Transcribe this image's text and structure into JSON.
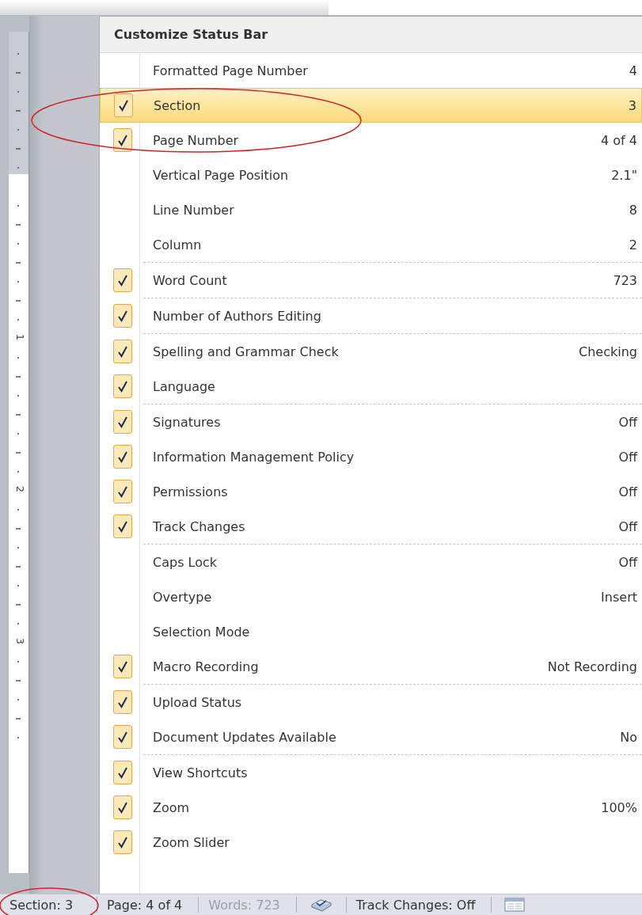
{
  "menu": {
    "title": "Customize Status Bar",
    "groups": [
      [
        {
          "label": "Formatted Page Number",
          "value": "4",
          "checked": false,
          "selected": false
        },
        {
          "label": "Section",
          "value": "3",
          "checked": true,
          "selected": true
        },
        {
          "label": "Page Number",
          "value": "4 of 4",
          "checked": true,
          "selected": false
        },
        {
          "label": "Vertical Page Position",
          "value": "2.1\"",
          "checked": false,
          "selected": false
        },
        {
          "label": "Line Number",
          "value": "8",
          "checked": false,
          "selected": false
        },
        {
          "label": "Column",
          "value": "2",
          "checked": false,
          "selected": false
        }
      ],
      [
        {
          "label": "Word Count",
          "value": "723",
          "checked": true,
          "selected": false
        }
      ],
      [
        {
          "label": "Number of Authors Editing",
          "checked": true,
          "selected": false
        }
      ],
      [
        {
          "label": "Spelling and Grammar Check",
          "value": "Checking",
          "checked": true,
          "selected": false
        },
        {
          "label": "Language",
          "checked": true,
          "selected": false
        }
      ],
      [
        {
          "label": "Signatures",
          "value": "Off",
          "checked": true,
          "selected": false
        },
        {
          "label": "Information Management Policy",
          "value": "Off",
          "checked": true,
          "selected": false
        },
        {
          "label": "Permissions",
          "value": "Off",
          "checked": true,
          "selected": false
        },
        {
          "label": "Track Changes",
          "value": "Off",
          "checked": true,
          "selected": false
        }
      ],
      [
        {
          "label": "Caps Lock",
          "value": "Off",
          "checked": false,
          "selected": false
        },
        {
          "label": "Overtype",
          "value": "Insert",
          "checked": false,
          "selected": false
        },
        {
          "label": "Selection Mode",
          "checked": false,
          "selected": false
        },
        {
          "label": "Macro Recording",
          "value": "Not Recording",
          "checked": true,
          "selected": false
        }
      ],
      [
        {
          "label": "Upload Status",
          "checked": true,
          "selected": false
        },
        {
          "label": "Document Updates Available",
          "value": "No",
          "checked": true,
          "selected": false
        }
      ],
      [
        {
          "label": "View Shortcuts",
          "checked": true,
          "selected": false
        },
        {
          "label": "Zoom",
          "value": "100%",
          "checked": true,
          "selected": false
        },
        {
          "label": "Zoom Slider",
          "checked": true,
          "selected": false
        }
      ]
    ]
  },
  "ruler": {
    "labels": [
      "1",
      "2",
      "3"
    ]
  },
  "status_bar": [
    {
      "kind": "text",
      "text": "Section: 3",
      "disabled": false
    },
    {
      "kind": "text",
      "text": "Page: 4 of 4",
      "disabled": false
    },
    {
      "kind": "text",
      "text": "Words: 723",
      "disabled": true
    },
    {
      "kind": "proofing"
    },
    {
      "kind": "text",
      "text": "Track Changes: Off",
      "disabled": false
    },
    {
      "kind": "layout"
    }
  ]
}
